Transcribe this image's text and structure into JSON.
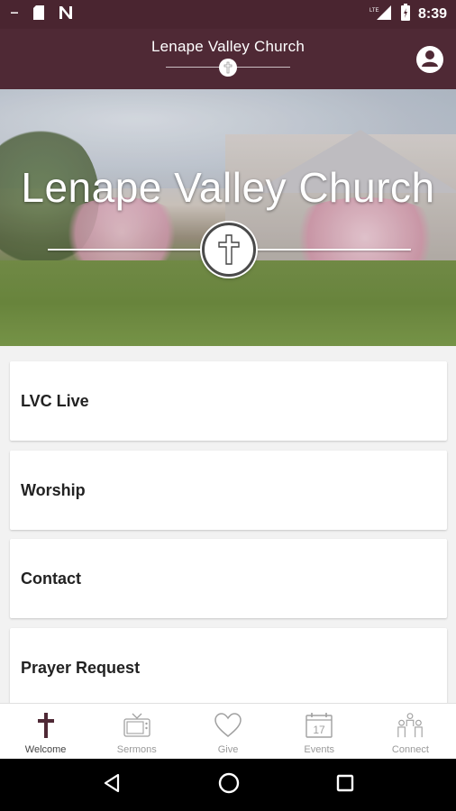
{
  "status_bar": {
    "time": "8:39",
    "network": "LTE",
    "left_icons": [
      "minus-icon",
      "sd-card-icon",
      "n-icon"
    ]
  },
  "app_bar": {
    "title": "Lenape Valley Church"
  },
  "hero": {
    "title": "Lenape Valley Church"
  },
  "menu": {
    "items": [
      {
        "label": "LVC Live"
      },
      {
        "label": "Worship"
      },
      {
        "label": "Contact"
      },
      {
        "label": "Prayer Request"
      }
    ]
  },
  "bottom_nav": {
    "items": [
      {
        "label": "Welcome",
        "icon": "cross-icon",
        "active": true
      },
      {
        "label": "Sermons",
        "icon": "tv-icon",
        "active": false
      },
      {
        "label": "Give",
        "icon": "heart-icon",
        "active": false
      },
      {
        "label": "Events",
        "icon": "calendar-icon",
        "active": false
      },
      {
        "label": "Connect",
        "icon": "people-icon",
        "active": false
      }
    ],
    "calendar_day": "17"
  },
  "colors": {
    "brand": "#4f2935",
    "status_bar": "#4a2530",
    "active_icon": "#4f2935",
    "inactive_icon": "#a0a0a0"
  }
}
